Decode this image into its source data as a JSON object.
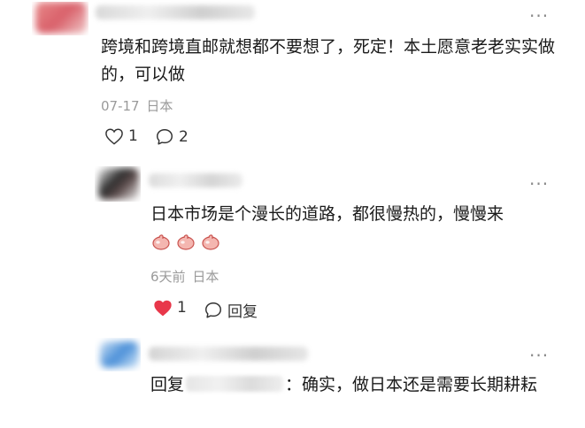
{
  "comments": [
    {
      "text": "跨境和跨境直邮就想都不要想了，死定！本土愿意老老实实做的，可以做",
      "date": "07-17",
      "region": "日本",
      "likes": "1",
      "replies": "2",
      "more_icon": "more-dots-icon"
    },
    {
      "text": "日本市场是个漫长的道路，都很慢热的，慢慢来",
      "emoji": [
        "thumbs-up-icon",
        "thumbs-up-icon",
        "thumbs-up-icon"
      ],
      "date": "6天前",
      "region": "日本",
      "likes": "1",
      "liked": true,
      "reply_label": "回复",
      "more_icon": "more-dots-icon"
    },
    {
      "reply_prefix": "回复",
      "text_after_name": "：确实，做日本还是需要长期耕耘",
      "more_icon": "more-dots-icon"
    }
  ],
  "colors": {
    "liked_heart": "#e8374a",
    "meta_text": "#9a9a9a"
  }
}
